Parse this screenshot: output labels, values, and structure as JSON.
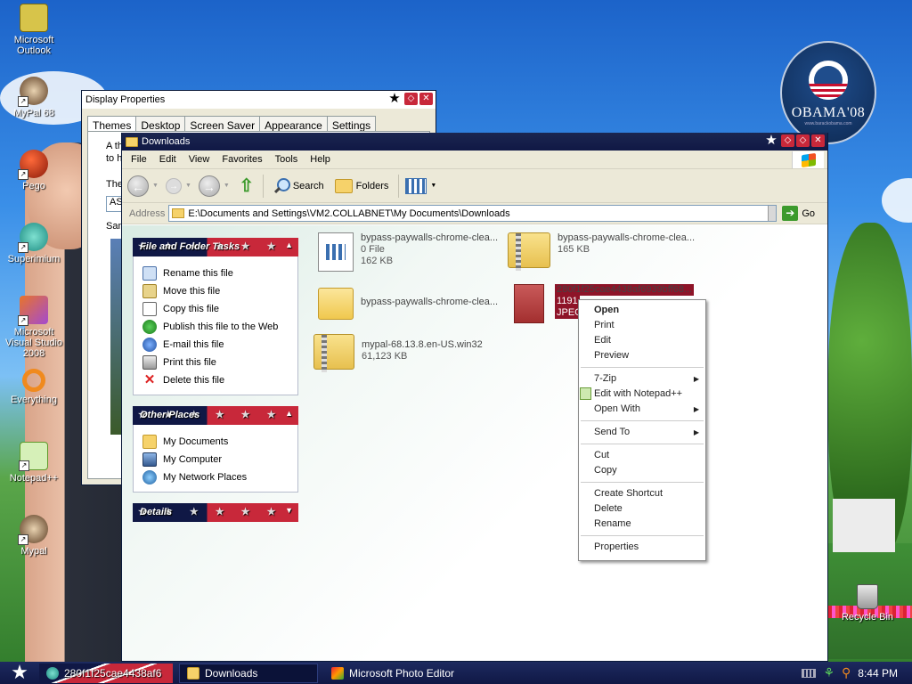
{
  "desktop": {
    "icons": [
      {
        "label": "Microsoft Outlook",
        "icon": "outlook-icon"
      },
      {
        "label": "MyPal 68",
        "icon": "mypal-icon"
      },
      {
        "label": "Pego",
        "icon": "pego-icon"
      },
      {
        "label": "Superimium",
        "icon": "superimium-icon"
      },
      {
        "label": "Microsoft Visual Studio 2008",
        "icon": "visual-studio-icon"
      },
      {
        "label": "Everything",
        "icon": "everything-icon"
      },
      {
        "label": "Notepad++",
        "icon": "notepadpp-icon"
      },
      {
        "label": "Mypal",
        "icon": "mypal-icon"
      },
      {
        "label": "Recycle Bin",
        "icon": "recycle-bin-icon"
      }
    ],
    "badge": {
      "text": "OBAMA'08",
      "sub": "www.barackobama.com"
    }
  },
  "display_properties": {
    "title": "Display Properties",
    "tabs": [
      "Themes",
      "Desktop",
      "Screen Saver",
      "Appearance",
      "Settings"
    ],
    "active_tab": "Themes",
    "text_line1": "A the",
    "text_line2": "to he",
    "theme_label": "Ther",
    "theme_value": "AS-",
    "sample_label": "Samp"
  },
  "explorer": {
    "title": "Downloads",
    "menu": [
      "File",
      "Edit",
      "View",
      "Favorites",
      "Tools",
      "Help"
    ],
    "toolbar": {
      "search": "Search",
      "folders": "Folders"
    },
    "address_label": "Address",
    "address_value": "E:\\Documents and Settings\\VM2.COLLABNET\\My Documents\\Downloads",
    "go_label": "Go",
    "panels": {
      "file_tasks": {
        "title": "File and Folder Tasks",
        "items": [
          "Rename this file",
          "Move this file",
          "Copy this file",
          "Publish this file to the Web",
          "E-mail this file",
          "Print this file",
          "Delete this file"
        ]
      },
      "other_places": {
        "title": "Other Places",
        "items": [
          "My Documents",
          "My Computer",
          "My Network Places"
        ]
      },
      "details": {
        "title": "Details"
      }
    },
    "files": [
      {
        "name": "bypass-paywalls-chrome-clea...",
        "line2": "0 File",
        "line3": "162 KB",
        "kind": "file"
      },
      {
        "name": "bypass-paywalls-chrome-clea...",
        "line2": "165 KB",
        "line3": "",
        "kind": "zip"
      },
      {
        "name": "bypass-paywalls-chrome-clea...",
        "line2": "",
        "line3": "",
        "kind": "folder"
      },
      {
        "name": "280f1f25cae4438af6939bff68...",
        "line2": "1191",
        "line3": "JPEG",
        "kind": "jpeg"
      },
      {
        "name": "mypal-68.13.8.en-US.win32",
        "line2": "61,123 KB",
        "line3": "",
        "kind": "zip"
      }
    ]
  },
  "context_menu": {
    "items": [
      {
        "label": "Open",
        "bold": true
      },
      {
        "label": "Print"
      },
      {
        "label": "Edit"
      },
      {
        "label": "Preview"
      },
      {
        "sep": true
      },
      {
        "label": "7-Zip",
        "submenu": true
      },
      {
        "label": "Edit with Notepad++",
        "icon": "notepadpp-icon"
      },
      {
        "label": "Open With",
        "submenu": true
      },
      {
        "sep": true
      },
      {
        "label": "Send To",
        "submenu": true
      },
      {
        "sep": true
      },
      {
        "label": "Cut"
      },
      {
        "label": "Copy"
      },
      {
        "sep": true
      },
      {
        "label": "Create Shortcut"
      },
      {
        "label": "Delete"
      },
      {
        "label": "Rename"
      },
      {
        "sep": true
      },
      {
        "label": "Properties"
      }
    ]
  },
  "taskbar": {
    "buttons": [
      {
        "label": "280f1f25cae4438af6",
        "active": false
      },
      {
        "label": "Downloads",
        "active": true
      },
      {
        "label": "Microsoft Photo Editor",
        "active": false
      }
    ],
    "clock": "8:44 PM"
  }
}
